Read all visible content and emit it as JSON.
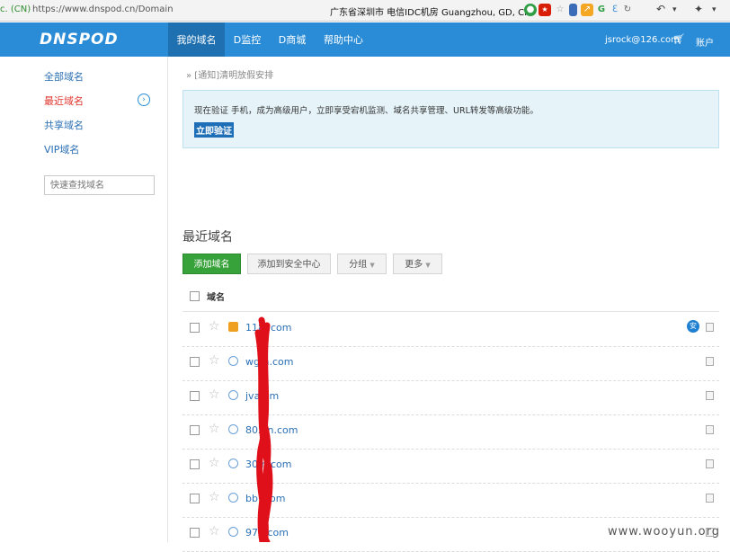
{
  "browser": {
    "cert_label": "c. (CN)",
    "url": "https://www.dnspod.cn/Domain",
    "geo": "广东省深圳市 电信IDC机房   Guangzhou, GD, CN"
  },
  "header": {
    "logo": "DNSPOD",
    "nav": [
      "我的域名",
      "D监控",
      "D商城",
      "帮助中心"
    ],
    "user_email": "jsrock@126.com",
    "account_label": "账户"
  },
  "sidebar": {
    "items": [
      "全部域名",
      "最近域名",
      "共享域名",
      "VIP域名"
    ],
    "search_placeholder": "快速查找域名"
  },
  "notice": "» [通知]清明放假安排",
  "verify": {
    "text": "现在验证 手机，成为高级用户，立即享受宕机监测、域名共享管理、URL转发等高级功能。",
    "button": "立即验证"
  },
  "section_title": "最近域名",
  "toolbar": {
    "add": "添加域名",
    "add_security": "添加到安全中心",
    "group": "分组",
    "more": "更多"
  },
  "table": {
    "column_name": "域名",
    "rows": [
      {
        "name": "118 .com",
        "icon": "orange"
      },
      {
        "name": "wg  n.com",
        "icon": "globe"
      },
      {
        "name": "jva   om",
        "icon": "globe"
      },
      {
        "name": "802   n.com",
        "icon": "globe"
      },
      {
        "name": "30   n.com",
        "icon": "globe"
      },
      {
        "name": "bb   .com",
        "icon": "globe"
      },
      {
        "name": "97b  com",
        "icon": "globe"
      }
    ]
  },
  "watermark": "www.wooyun.org"
}
